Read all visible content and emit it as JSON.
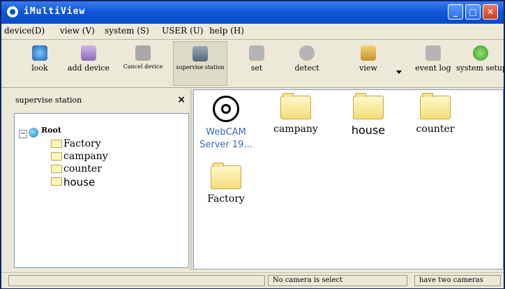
{
  "window": {
    "title": "iMultiView"
  },
  "menu": [
    {
      "label": "device(D)"
    },
    {
      "label": "view (V)"
    },
    {
      "label": "system (S)"
    },
    {
      "label": "USER (U)"
    },
    {
      "label": "help (H)"
    }
  ],
  "toolbar": [
    {
      "label": "look",
      "icon": "look-icon"
    },
    {
      "label": "add device",
      "icon": "add-device-icon"
    },
    {
      "label": "Cancel device",
      "icon": "cancel-device-icon"
    },
    {
      "label": "supervise station",
      "icon": "supervise-station-icon"
    },
    {
      "label": "set",
      "icon": "set-icon"
    },
    {
      "label": "detect",
      "icon": "detect-icon"
    },
    {
      "label": "view",
      "icon": "view-icon"
    },
    {
      "label": "event log",
      "icon": "event-log-icon"
    },
    {
      "label": "system setup",
      "icon": "system-setup-icon"
    }
  ],
  "panel": {
    "title": "supervise station",
    "close": "×"
  },
  "tree": {
    "root": "Root",
    "children": [
      "Factory",
      "campany",
      "counter",
      "house"
    ]
  },
  "content": [
    {
      "label": "WebCAM Server 19...",
      "type": "camera"
    },
    {
      "label": "campany",
      "type": "folder"
    },
    {
      "label": "house",
      "type": "folder"
    },
    {
      "label": "counter",
      "type": "folder"
    },
    {
      "label": "Factory",
      "type": "folder"
    }
  ],
  "status": {
    "camera": "No camera is select",
    "count": "have two cameras"
  }
}
